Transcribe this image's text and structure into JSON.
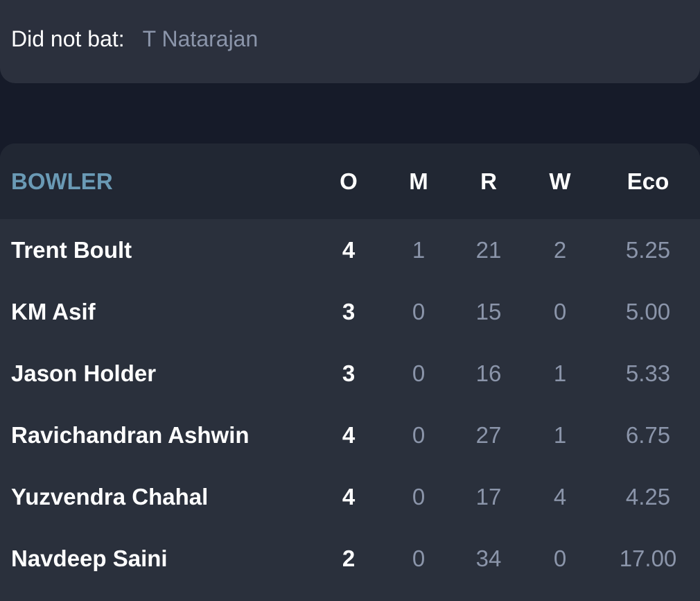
{
  "did_not_bat": {
    "label": "Did not bat:",
    "players": "T Natarajan"
  },
  "bowling": {
    "headers": {
      "bowler": "BOWLER",
      "o": "O",
      "m": "M",
      "r": "R",
      "w": "W",
      "eco": "Eco"
    },
    "rows": [
      {
        "name": "Trent Boult",
        "o": "4",
        "m": "1",
        "r": "21",
        "w": "2",
        "eco": "5.25"
      },
      {
        "name": "KM Asif",
        "o": "3",
        "m": "0",
        "r": "15",
        "w": "0",
        "eco": "5.00"
      },
      {
        "name": "Jason Holder",
        "o": "3",
        "m": "0",
        "r": "16",
        "w": "1",
        "eco": "5.33"
      },
      {
        "name": "Ravichandran Ashwin",
        "o": "4",
        "m": "0",
        "r": "27",
        "w": "1",
        "eco": "6.75"
      },
      {
        "name": "Yuzvendra Chahal",
        "o": "4",
        "m": "0",
        "r": "17",
        "w": "4",
        "eco": "4.25"
      },
      {
        "name": "Navdeep Saini",
        "o": "2",
        "m": "0",
        "r": "34",
        "w": "0",
        "eco": "17.00"
      }
    ]
  }
}
